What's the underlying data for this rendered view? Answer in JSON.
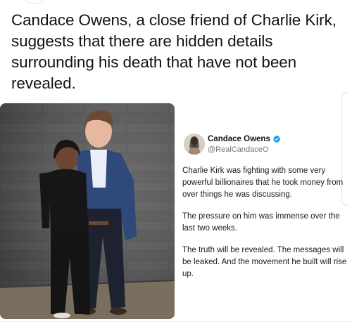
{
  "post": {
    "text": "Candace Owens, a close friend of Charlie Kirk, suggests that there are hidden details surrounding his death that have not been revealed."
  },
  "embedded_tweet": {
    "author_name": "Candace Owens",
    "author_handle": "@RealCandaceO",
    "verified": true,
    "paragraphs": [
      "Charlie Kirk was fighting with some very powerful billionaires that he took money from over things he was discussing.",
      "The pressure on him was immense over the last two weeks.",
      "The truth will be revealed. The messages will be leaked. And the movement he built will rise up."
    ]
  },
  "colors": {
    "text": "#0f1419",
    "muted": "#6b7680",
    "verified_blue": "#1d9bf0"
  },
  "icons": [
    "verified-badge-icon"
  ]
}
